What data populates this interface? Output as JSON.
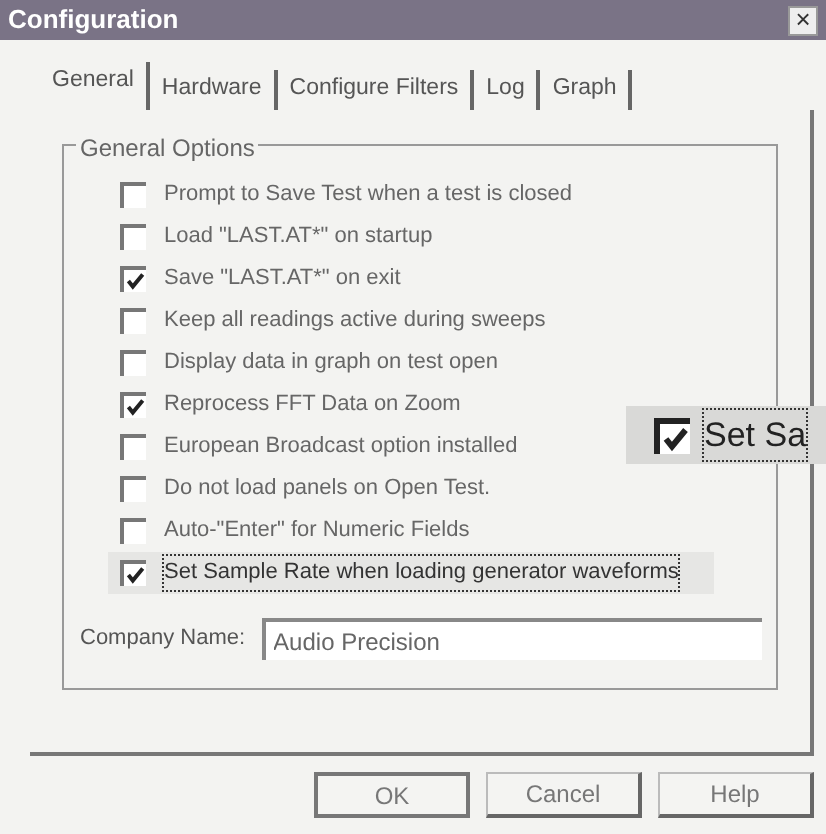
{
  "window": {
    "title": "Configuration",
    "close": "×"
  },
  "tabs": [
    {
      "label": "General",
      "selected": true
    },
    {
      "label": "Hardware",
      "selected": false
    },
    {
      "label": "Configure Filters",
      "selected": false
    },
    {
      "label": "Log",
      "selected": false
    },
    {
      "label": "Graph",
      "selected": false
    }
  ],
  "group": {
    "title": "General Options",
    "options": [
      {
        "label": "Prompt to Save Test  when a test is closed",
        "checked": false,
        "focused": false
      },
      {
        "label": "Load \"LAST.AT*\" on startup",
        "checked": false,
        "focused": false
      },
      {
        "label": "Save \"LAST.AT*\" on exit",
        "checked": true,
        "focused": false
      },
      {
        "label": "Keep all readings active during sweeps",
        "checked": false,
        "focused": false
      },
      {
        "label": "Display data in graph on test open",
        "checked": false,
        "focused": false
      },
      {
        "label": "Reprocess FFT Data on Zoom",
        "checked": true,
        "focused": false
      },
      {
        "label": "European Broadcast option installed",
        "checked": false,
        "focused": false
      },
      {
        "label": "Do not load panels on Open Test.",
        "checked": false,
        "focused": false
      },
      {
        "label": "Auto-\"Enter\" for Numeric Fields",
        "checked": false,
        "focused": false
      },
      {
        "label": "Set Sample Rate when loading generator waveforms",
        "checked": true,
        "focused": true
      }
    ],
    "company": {
      "label": "Company Name:",
      "value": "Audio Precision"
    }
  },
  "zoom_callout": {
    "label": "Set Sa",
    "checked": true
  },
  "buttons": [
    "OK",
    "Cancel",
    "Help"
  ]
}
